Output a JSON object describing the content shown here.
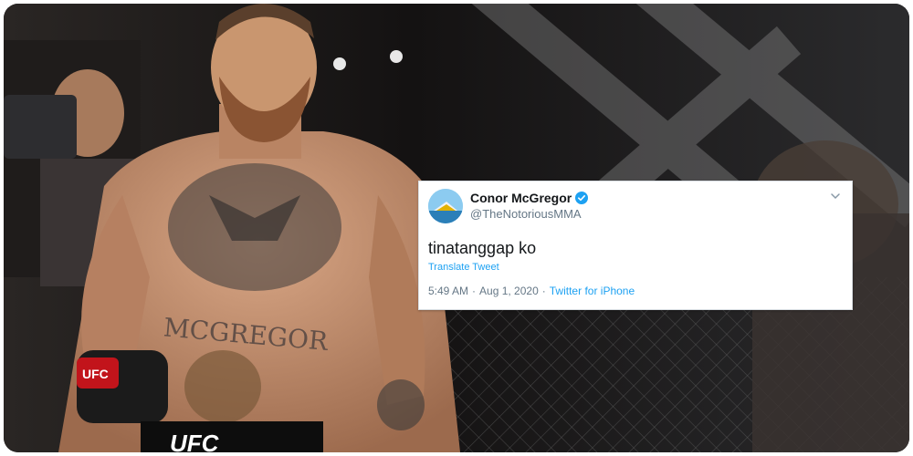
{
  "photo": {
    "trunks_brand": "UFC",
    "tattoo_text": "MCGREGOR",
    "glove_text": "UFC"
  },
  "tweet": {
    "display_name": "Conor McGregor",
    "handle": "@TheNotoriousMMA",
    "text": "tinatanggap ko",
    "translate_label": "Translate Tweet",
    "time": "5:49 AM",
    "date": "Aug 1, 2020",
    "separator": "·",
    "source": "Twitter for iPhone",
    "verified_icon": "verified-badge-icon",
    "menu_icon": "chevron-down-icon"
  },
  "colors": {
    "link": "#1da1f2",
    "secondary_text": "#657786",
    "primary_text": "#14171a",
    "verified": "#1da1f2"
  }
}
